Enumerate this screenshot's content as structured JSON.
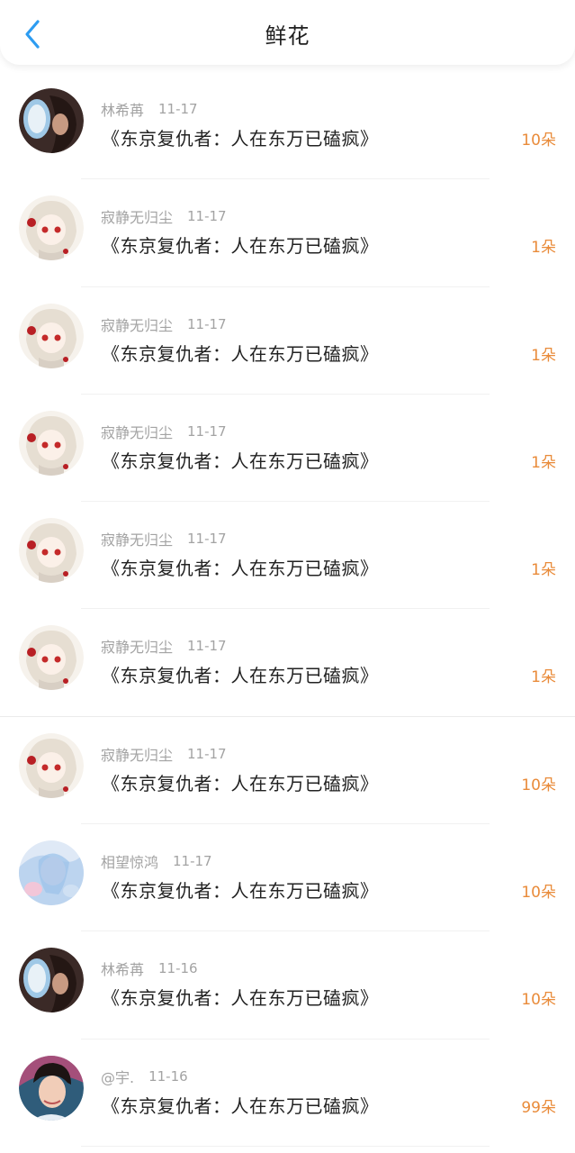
{
  "header": {
    "title": "鲜花"
  },
  "colors": {
    "accent": "#e98b3a",
    "back_icon": "#2d9cf1"
  },
  "records": [
    {
      "user": "林希苒",
      "date": "11-17",
      "book": "《东京复仇者：人在东万已磕疯》",
      "amount": "10朵",
      "avatar": "photo-avatar-window"
    },
    {
      "user": "寂静无归尘",
      "date": "11-17",
      "book": "《东京复仇者：人在东万已磕疯》",
      "amount": "1朵",
      "avatar": "anime-avatar-white-hair"
    },
    {
      "user": "寂静无归尘",
      "date": "11-17",
      "book": "《东京复仇者：人在东万已磕疯》",
      "amount": "1朵",
      "avatar": "anime-avatar-white-hair"
    },
    {
      "user": "寂静无归尘",
      "date": "11-17",
      "book": "《东京复仇者：人在东万已磕疯》",
      "amount": "1朵",
      "avatar": "anime-avatar-white-hair"
    },
    {
      "user": "寂静无归尘",
      "date": "11-17",
      "book": "《东京复仇者：人在东万已磕疯》",
      "amount": "1朵",
      "avatar": "anime-avatar-white-hair"
    },
    {
      "user": "寂静无归尘",
      "date": "11-17",
      "book": "《东京复仇者：人在东万已磕疯》",
      "amount": "1朵",
      "avatar": "anime-avatar-white-hair"
    },
    {
      "user": "寂静无归尘",
      "date": "11-17",
      "book": "《东京复仇者：人在东万已磕疯》",
      "amount": "10朵",
      "avatar": "anime-avatar-white-hair"
    },
    {
      "user": "相望惊鸿",
      "date": "11-17",
      "book": "《东京复仇者：人在东万已磕疯》",
      "amount": "10朵",
      "avatar": "anime-avatar-blue"
    },
    {
      "user": "林希苒",
      "date": "11-16",
      "book": "《东京复仇者：人在东万已磕疯》",
      "amount": "10朵",
      "avatar": "photo-avatar-window"
    },
    {
      "user": "@宇.",
      "date": "11-16",
      "book": "《东京复仇者：人在东万已磕疯》",
      "amount": "99朵",
      "avatar": "photo-avatar-person"
    }
  ]
}
